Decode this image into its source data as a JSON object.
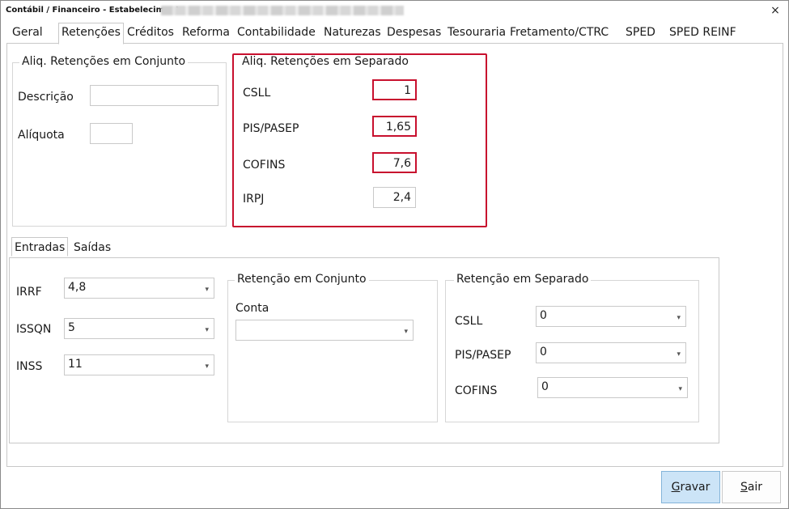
{
  "window": {
    "title": "Contábil / Financeiro - Estabelecimento",
    "close_glyph": "×"
  },
  "tabs": [
    {
      "label": "Geral"
    },
    {
      "label": "Retenções"
    },
    {
      "label": "Créditos"
    },
    {
      "label": "Reforma"
    },
    {
      "label": "Contabilidade"
    },
    {
      "label": "Naturezas"
    },
    {
      "label": "Despesas"
    },
    {
      "label": "Tesouraria"
    },
    {
      "label": "Fretamento/CTRC"
    },
    {
      "label": "SPED"
    },
    {
      "label": "SPED REINF"
    }
  ],
  "conjunto": {
    "title": "Aliq. Retenções em Conjunto",
    "descricao_label": "Descrição",
    "descricao_value": "",
    "aliquota_label": "Alíquota",
    "aliquota_value": ""
  },
  "separado": {
    "title": "Aliq. Retenções em Separado",
    "fields": [
      {
        "label": "CSLL",
        "value": "1"
      },
      {
        "label": "PIS/PASEP",
        "value": "1,65"
      },
      {
        "label": "COFINS",
        "value": "7,6"
      },
      {
        "label": "IRPJ",
        "value": "2,4"
      }
    ],
    "highlight_color": "#c8102e"
  },
  "subtabs": [
    {
      "label": "Entradas"
    },
    {
      "label": "Saídas"
    }
  ],
  "entradas": {
    "irrf_label": "IRRF",
    "irrf_value": "4,8",
    "issqn_label": "ISSQN",
    "issqn_value": "5",
    "inss_label": "INSS",
    "inss_value": "11",
    "ret_conjunto": {
      "title": "Retenção em Conjunto",
      "conta_label": "Conta",
      "conta_value": ""
    },
    "ret_separado": {
      "title": "Retenção em Separado",
      "fields": [
        {
          "label": "CSLL",
          "value": "0"
        },
        {
          "label": "PIS/PASEP",
          "value": "0"
        },
        {
          "label": "COFINS",
          "value": "0"
        }
      ]
    }
  },
  "buttons": {
    "gravar_prefix": "G",
    "gravar_rest": "ravar",
    "sair_prefix": "S",
    "sair_rest": "air"
  },
  "colors": {
    "accent_button": "#cce4f7",
    "border": "#c9c9c9"
  },
  "icons": {
    "dropdown": "chevron-down-icon",
    "close": "close-icon"
  },
  "dropdown_glyph": "▾"
}
